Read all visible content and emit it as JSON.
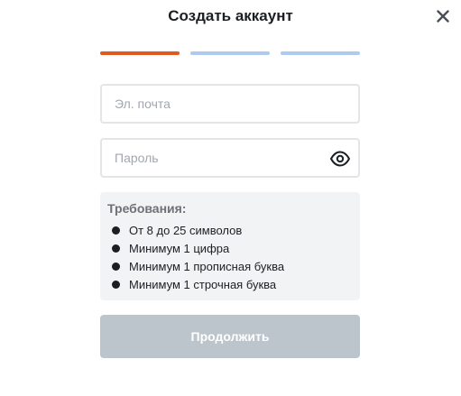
{
  "dialog": {
    "title": "Создать аккаунт",
    "close_icon": "close-icon"
  },
  "progress": {
    "total_steps": 3,
    "current_step": 1,
    "colors": {
      "active": "#e05a1f",
      "inactive": "#aecbef"
    }
  },
  "form": {
    "email": {
      "placeholder": "Эл. почта",
      "value": ""
    },
    "password": {
      "placeholder": "Пароль",
      "value": "",
      "toggle_icon": "eye-icon"
    }
  },
  "requirements": {
    "title": "Требования:",
    "items": [
      {
        "label": "От 8 до 25 символов"
      },
      {
        "label": "Минимум 1 цифра"
      },
      {
        "label": "Минимум 1 прописная буква"
      },
      {
        "label": "Минимум 1 строчная буква"
      }
    ]
  },
  "actions": {
    "continue_label": "Продолжить",
    "continue_disabled": true,
    "continue_color": "#bcc5cc"
  }
}
